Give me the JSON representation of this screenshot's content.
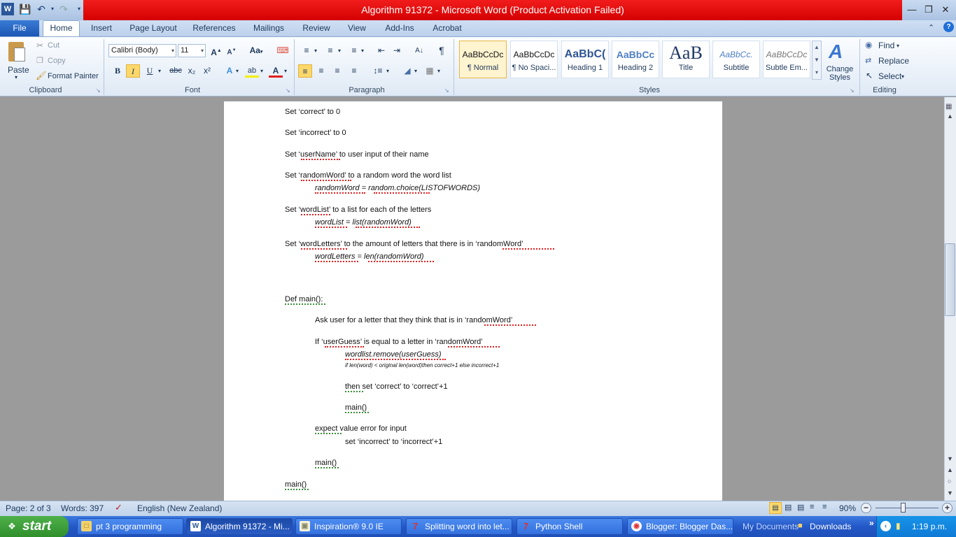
{
  "window": {
    "title": "Algorithm 91372  -  Microsoft Word (Product Activation Failed)"
  },
  "qat": {
    "icons": [
      "word-icon",
      "save-icon",
      "undo-icon",
      "redo-icon",
      "customize-icon"
    ]
  },
  "tabs": {
    "file": "File",
    "home": "Home",
    "insert": "Insert",
    "page_layout": "Page Layout",
    "references": "References",
    "mailings": "Mailings",
    "review": "Review",
    "view": "View",
    "addins": "Add-Ins",
    "acrobat": "Acrobat"
  },
  "clipboard": {
    "paste": "Paste",
    "cut": "Cut",
    "copy": "Copy",
    "format_painter": "Format Painter",
    "label": "Clipboard"
  },
  "font": {
    "name": "Calibri (Body)",
    "size": "11",
    "label": "Font",
    "bold": "B",
    "italic": "I",
    "underline": "U",
    "strike": "abc",
    "sub": "x₂",
    "sup": "x²"
  },
  "paragraph": {
    "label": "Paragraph"
  },
  "styles": {
    "label": "Styles",
    "change": "Change Styles",
    "items": [
      {
        "preview": "AaBbCcDc",
        "name": "¶ Normal"
      },
      {
        "preview": "AaBbCcDc",
        "name": "¶ No Spaci..."
      },
      {
        "preview": "AaBbC(",
        "name": "Heading 1"
      },
      {
        "preview": "AaBbCc",
        "name": "Heading 2"
      },
      {
        "preview": "AaB",
        "name": "Title"
      },
      {
        "preview": "AaBbCc.",
        "name": "Subtitle"
      },
      {
        "preview": "AaBbCcDc",
        "name": "Subtle Em..."
      }
    ]
  },
  "editing": {
    "find": "Find",
    "replace": "Replace",
    "select": "Select",
    "label": "Editing"
  },
  "document": {
    "lines": [
      "Set ‘correct’ to 0",
      "Set ‘incorrect’ to 0",
      "Set ‘userName’ to user input of their name",
      "Set ‘randomWord’ to a random word the word list",
      "randomWord = random.choice(LISTOFWORDS)",
      "Set ‘wordList’ to a list for each of the letters",
      "wordList = list(randomWord)",
      "Set ‘wordLetters’ to the amount of letters that there is in ‘randomWord’",
      "wordLetters  = len(randomWord)",
      "Def main():",
      "Ask user for a letter that they think that is in ‘randomWord’",
      "If ‘userGuess’ is equal to a letter in ‘randomWord’",
      "wordlist.remove(userGuess)",
      "if len(word) < original len(word)then correct+1 else incorrect+1",
      "then set ‘correct’ to ‘correct’+1",
      "main()",
      "expect value error for input",
      "set ‘incorrect’ to ‘incorrect’+1",
      "main()",
      "main()"
    ]
  },
  "status": {
    "page": "Page: 2 of 3",
    "words": "Words: 397",
    "language": "English (New Zealand)",
    "zoom": "90%"
  },
  "taskbar": {
    "start": "start",
    "items": [
      {
        "label": "pt 3 programming",
        "icon": "folder-icon"
      },
      {
        "label": "Algorithm 91372 - Mi...",
        "icon": "word-icon"
      },
      {
        "label": "Inspiration® 9.0 IE",
        "icon": "inspiration-icon"
      },
      {
        "label": "Splitting word into let...",
        "icon": "python-icon"
      },
      {
        "label": "Python Shell",
        "icon": "python-icon"
      },
      {
        "label": "Blogger: Blogger Das...",
        "icon": "chrome-icon"
      }
    ],
    "my_documents": "My Documents",
    "downloads": "Downloads",
    "time": "1:19 p.m."
  }
}
